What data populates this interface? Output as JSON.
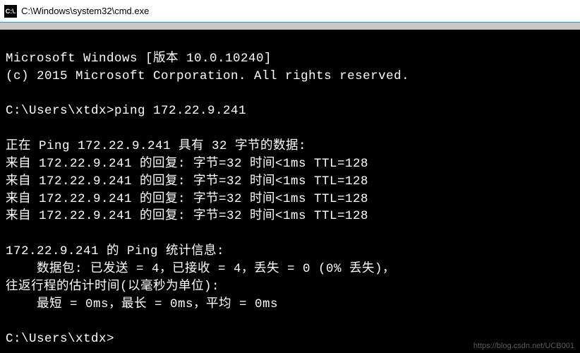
{
  "window": {
    "title": "C:\\Windows\\system32\\cmd.exe",
    "icon_label": "C:\\."
  },
  "console": {
    "header_version": "Microsoft Windows [版本 10.0.10240]",
    "header_copyright": "(c) 2015 Microsoft Corporation. All rights reserved.",
    "prompt1": "C:\\Users\\xtdx>",
    "command1": "ping 172.22.9.241",
    "ping_header": "正在 Ping 172.22.9.241 具有 32 字节的数据:",
    "reply1": "来自 172.22.9.241 的回复: 字节=32 时间<1ms TTL=128",
    "reply2": "来自 172.22.9.241 的回复: 字节=32 时间<1ms TTL=128",
    "reply3": "来自 172.22.9.241 的回复: 字节=32 时间<1ms TTL=128",
    "reply4": "来自 172.22.9.241 的回复: 字节=32 时间<1ms TTL=128",
    "stats_header": "172.22.9.241 的 Ping 统计信息:",
    "stats_packets": "    数据包: 已发送 = 4，已接收 = 4，丢失 = 0 (0% 丢失)，",
    "rtt_header": "往返行程的估计时间(以毫秒为单位):",
    "rtt_values": "    最短 = 0ms，最长 = 0ms，平均 = 0ms",
    "prompt2": "C:\\Users\\xtdx>"
  },
  "watermark": "https://blog.csdn.net/UCB001"
}
